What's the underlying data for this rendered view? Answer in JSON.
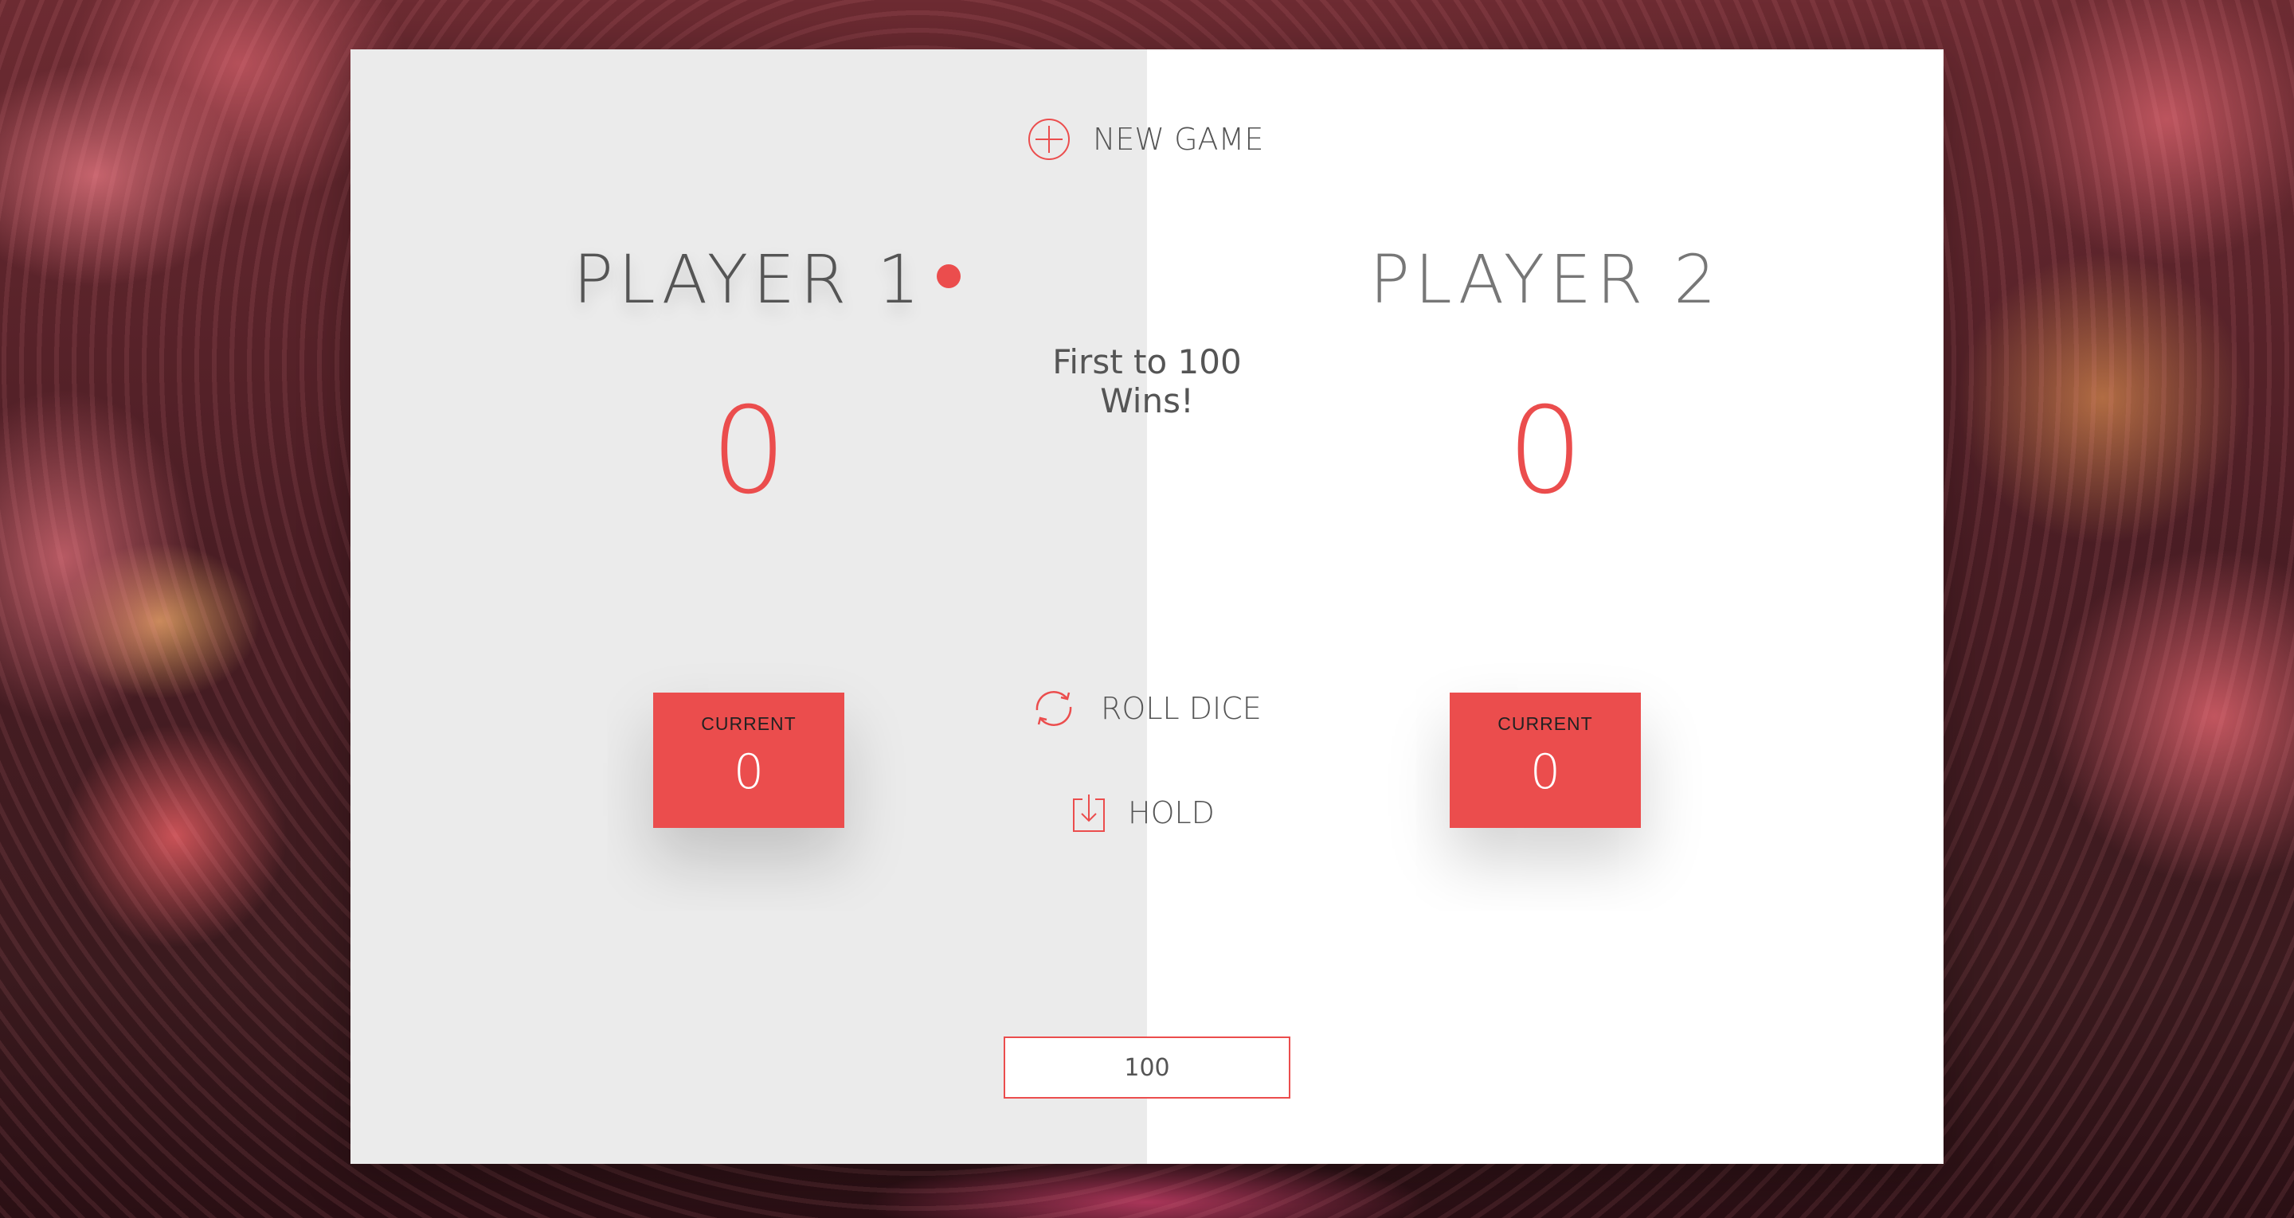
{
  "controls": {
    "new_game": "NEW GAME",
    "roll_dice": "ROLL DICE",
    "hold": "HOLD"
  },
  "target": {
    "text": "First to 100 Wins!",
    "input_value": "100"
  },
  "players": [
    {
      "name": "PLAYER 1",
      "score": "0",
      "current_label": "CURRENT",
      "current_score": "0",
      "active": true
    },
    {
      "name": "PLAYER 2",
      "score": "0",
      "current_label": "CURRENT",
      "current_score": "0",
      "active": false
    }
  ],
  "colors": {
    "accent": "#eb4d4d",
    "active_panel": "#ebebeb",
    "inactive_panel": "#ffffff",
    "text": "#555555"
  },
  "icons": {
    "new_game": "plus-circle-icon",
    "roll_dice": "refresh-icon",
    "hold": "download-icon",
    "active_player": "active-dot-icon"
  }
}
